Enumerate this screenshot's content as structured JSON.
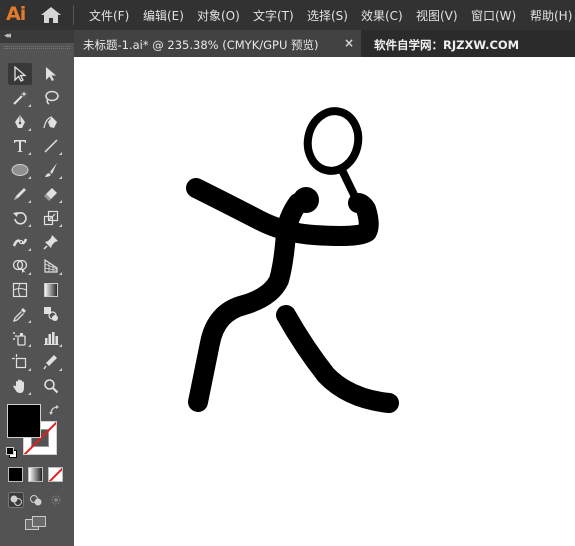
{
  "app": {
    "logo": "Ai"
  },
  "menu": {
    "items": [
      {
        "label": "文件(F)"
      },
      {
        "label": "编辑(E)"
      },
      {
        "label": "对象(O)"
      },
      {
        "label": "文字(T)"
      },
      {
        "label": "选择(S)"
      },
      {
        "label": "效果(C)"
      },
      {
        "label": "视图(V)"
      },
      {
        "label": "窗口(W)"
      },
      {
        "label": "帮助(H)"
      }
    ]
  },
  "tabs": [
    {
      "label": "未标题-1.ai* @ 235.38% (CMYK/GPU 预览)",
      "close": "×"
    },
    {
      "label": "软件自学网：RJZXW.COM"
    }
  ],
  "toolbar": {
    "collapse": "◂◂",
    "tools": [
      "selection-tool-icon",
      "direct-selection-tool-icon",
      "magic-wand-tool-icon",
      "lasso-tool-icon",
      "pen-tool-icon",
      "curvature-tool-icon",
      "type-tool-icon",
      "line-segment-tool-icon",
      "ellipse-tool-icon",
      "paintbrush-tool-icon",
      "shaper-tool-icon",
      "eraser-tool-icon",
      "rotate-tool-icon",
      "scale-tool-icon",
      "puppet-warp-tool-icon",
      "pin-tool-icon",
      "shape-builder-tool-icon",
      "perspective-grid-tool-icon",
      "mesh-tool-icon",
      "gradient-tool-icon",
      "eyedropper-tool-icon",
      "blend-tool-icon",
      "symbol-sprayer-tool-icon",
      "column-graph-tool-icon",
      "artboard-tool-icon",
      "slice-tool-icon",
      "hand-tool-icon",
      "zoom-tool-icon"
    ],
    "fill_color": "#000000",
    "stroke_color": "none"
  }
}
